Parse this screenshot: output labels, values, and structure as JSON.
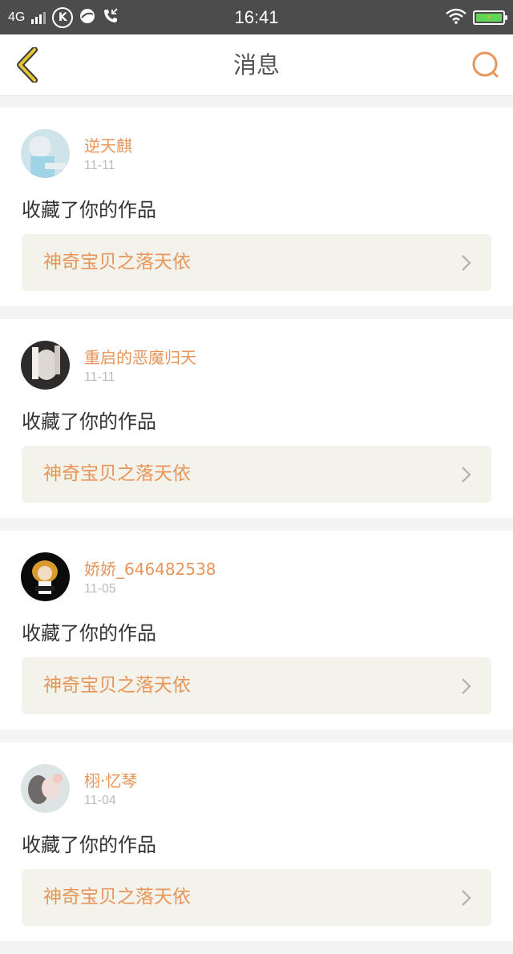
{
  "status_bar": {
    "network": "4G",
    "time": "16:41",
    "k_badge": "K"
  },
  "header": {
    "title": "消息",
    "back_icon": "chevron-left-icon",
    "search_icon": "search-icon"
  },
  "colors": {
    "accent": "#e8955a",
    "back_icon": "#e6c533",
    "card_link_bg": "#f3f3ec"
  },
  "messages": [
    {
      "username": "逆天麒",
      "date": "11-11",
      "action": "收藏了你的作品",
      "work_title": "神奇宝贝之落天依"
    },
    {
      "username": "重启的恶魔归天",
      "date": "11-11",
      "action": "收藏了你的作品",
      "work_title": "神奇宝贝之落天依"
    },
    {
      "username": "娇娇_646482538",
      "date": "11-05",
      "action": "收藏了你的作品",
      "work_title": "神奇宝贝之落天依"
    },
    {
      "username": "栩·忆琴",
      "date": "11-04",
      "action": "收藏了你的作品",
      "work_title": "神奇宝贝之落天依"
    }
  ]
}
